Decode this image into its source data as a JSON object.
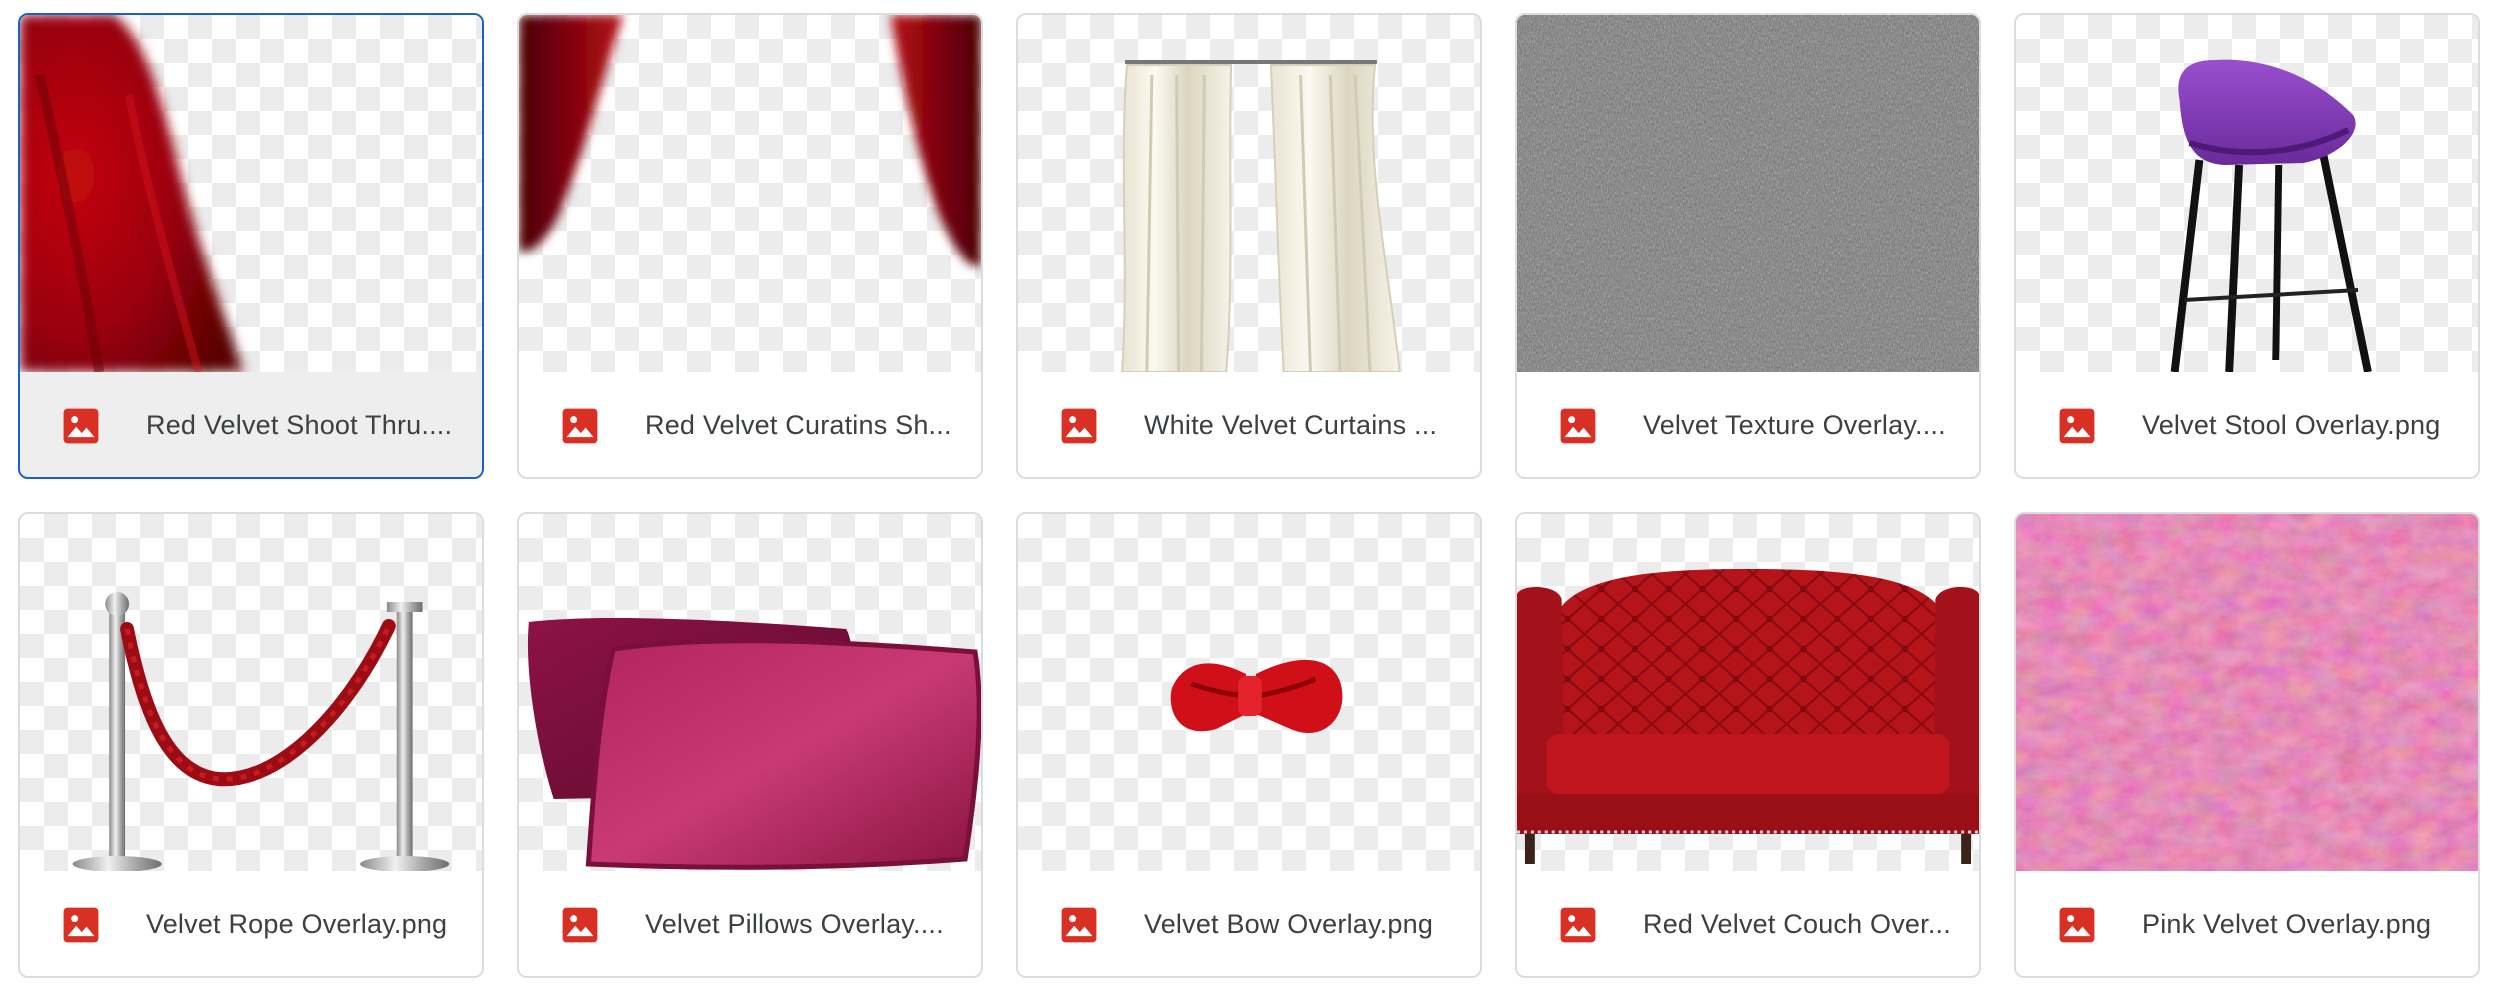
{
  "files": [
    {
      "name": "Red Velvet Shoot Thru....",
      "icon": "image-file-icon",
      "selected": true
    },
    {
      "name": "Red Velvet Curatins Sh...",
      "icon": "image-file-icon"
    },
    {
      "name": "White Velvet Curtains ...",
      "icon": "image-file-icon"
    },
    {
      "name": "Velvet Texture Overlay....",
      "icon": "image-file-icon"
    },
    {
      "name": "Velvet Stool Overlay.png",
      "icon": "image-file-icon"
    },
    {
      "name": "Velvet Rope Overlay.png",
      "icon": "image-file-icon"
    },
    {
      "name": "Velvet Pillows Overlay....",
      "icon": "image-file-icon"
    },
    {
      "name": "Velvet Bow Overlay.png",
      "icon": "image-file-icon"
    },
    {
      "name": "Red Velvet Couch Over...",
      "icon": "image-file-icon"
    },
    {
      "name": "Pink Velvet Overlay.png",
      "icon": "image-file-icon"
    }
  ],
  "colors": {
    "selected_border": "#1a5fd1",
    "image_icon": "#d93025",
    "card_border": "#dadce0"
  }
}
